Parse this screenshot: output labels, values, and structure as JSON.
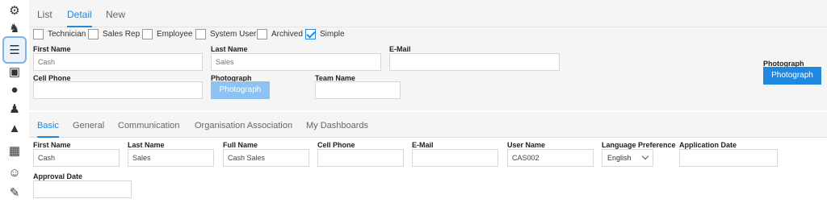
{
  "rail": {
    "icons": [
      "technician-icon",
      "horse-icon",
      "users-icon",
      "scanner-icon",
      "bob-icon",
      "team-icon",
      "truck-icon",
      "flags-icon",
      "person-icon",
      "wrench-icon"
    ]
  },
  "top_tabs": {
    "list": "List",
    "detail": "Detail",
    "new": "New"
  },
  "roles": [
    {
      "label": "Technician",
      "checked": false
    },
    {
      "label": "Sales Rep",
      "checked": false
    },
    {
      "label": "Employee",
      "checked": false
    },
    {
      "label": "System User",
      "checked": false
    },
    {
      "label": "Archived",
      "checked": false
    },
    {
      "label": "Simple",
      "checked": true
    }
  ],
  "detail": {
    "first_name_label": "First Name",
    "first_name_value": "Cash",
    "last_name_label": "Last Name",
    "last_name_value": "Sales",
    "email_label": "E-Mail",
    "email_value": "",
    "cell_phone_label": "Cell Phone",
    "cell_phone_value": "",
    "photograph_label": "Photograph",
    "photograph_button": "Photograph",
    "team_name_label": "Team Name",
    "team_name_value": "",
    "right_photograph_label": "Photograph",
    "right_photograph_button": "Photograph"
  },
  "bottom_tabs": [
    "Basic",
    "General",
    "Communication",
    "Organisation Association",
    "My Dashboards"
  ],
  "basic": {
    "first_name_label": "First Name",
    "first_name_value": "Cash",
    "last_name_label": "Last Name",
    "last_name_value": "Sales",
    "full_name_label": "Full Name",
    "full_name_value": "Cash Sales",
    "cell_phone_label": "Cell Phone",
    "cell_phone_value": "",
    "email_label": "E-Mail",
    "email_value": "",
    "user_name_label": "User Name",
    "user_name_value": "CAS002",
    "language_label": "Language Preference",
    "language_value": "English",
    "application_date_label": "Application Date",
    "application_date_value": "",
    "approval_date_label": "Approval Date",
    "approval_date_value": ""
  },
  "colors": {
    "accent": "#2188e2",
    "accent_faded": "#8cc3f2"
  }
}
